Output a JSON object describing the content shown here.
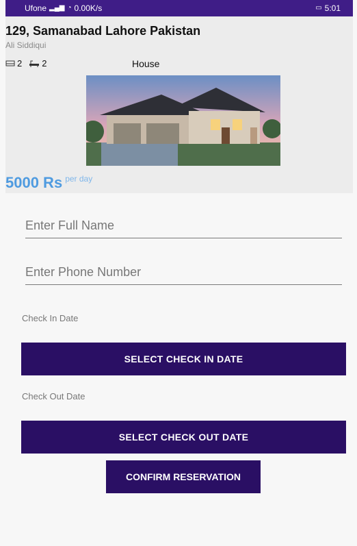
{
  "status_bar": {
    "carrier": "Ufone",
    "speed": "0.00K/s",
    "time": "5:01",
    "icons": [
      "signal-icon",
      "wifi-icon",
      "battery-icon"
    ]
  },
  "listing": {
    "title": "129, Samanabad Lahore Pakistan",
    "owner": "Ali Siddiqui",
    "beds": "2",
    "baths": "2",
    "type": "House",
    "price": "5000 Rs",
    "price_unit": "per day"
  },
  "form": {
    "full_name_placeholder": "Enter Full Name",
    "phone_placeholder": "Enter Phone Number",
    "check_in_label": "Check In Date",
    "check_in_button": "SELECT CHECK IN DATE",
    "check_out_label": "Check Out Date",
    "check_out_button": "SELECT CHECK OUT DATE",
    "confirm_button": "CONFIRM RESERVATION"
  },
  "colors": {
    "status_bar": "#3f1d87",
    "button": "#2a0f64",
    "price": "#4f9be0"
  }
}
